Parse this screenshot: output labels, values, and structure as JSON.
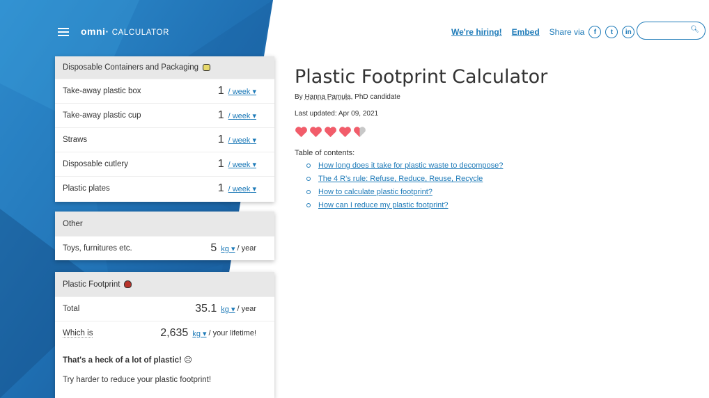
{
  "header": {
    "logo_omni": "omni",
    "logo_calc": "CALCULATOR",
    "hiring_link": "We're hiring!",
    "embed_link": "Embed",
    "share_label": "Share via",
    "social": [
      "f",
      "t",
      "in"
    ],
    "search_placeholder": ""
  },
  "cards": {
    "containers": {
      "title": "Disposable Containers and Packaging",
      "rows": [
        {
          "label": "Take-away plastic box",
          "value": "1",
          "unit": "/ week"
        },
        {
          "label": "Take-away plastic cup",
          "value": "1",
          "unit": "/ week"
        },
        {
          "label": "Straws",
          "value": "1",
          "unit": "/ week"
        },
        {
          "label": "Disposable cutlery",
          "value": "1",
          "unit": "/ week"
        },
        {
          "label": "Plastic plates",
          "value": "1",
          "unit": "/ week"
        }
      ]
    },
    "other": {
      "title": "Other",
      "rows": [
        {
          "label": "Toys, furnitures etc.",
          "value": "5",
          "unit": "kg",
          "suffix": "/ year"
        }
      ]
    },
    "footprint": {
      "title": "Plastic Footprint",
      "rows": [
        {
          "label": "Total",
          "value": "35.1",
          "unit": "kg",
          "suffix": "/ year"
        },
        {
          "label": "Which is",
          "value": "2,635",
          "unit": "kg",
          "suffix": "/ your lifetime!"
        }
      ],
      "message_bold": "That's a heck of a lot of plastic! ☹",
      "message": "Try harder to reduce your plastic footprint!"
    }
  },
  "article": {
    "title": "Plastic Footprint Calculator",
    "by": "By",
    "author": "Hanna Pamuła",
    "author_suffix": ", PhD candidate",
    "updated": "Last updated: Apr 09, 2021",
    "rating": 4.5,
    "toc_title": "Table of contents:",
    "toc": [
      "How long does it take for plastic waste to decompose?",
      "The 4 R's rule: Refuse, Reduce, Reuse, Recycle",
      "How to calculate plastic footprint?",
      "How can I reduce my plastic footprint?"
    ]
  },
  "colors": {
    "accent": "#1d7ab8",
    "heart": "#f25c6a",
    "bg_blue": "#2b7bbf"
  }
}
